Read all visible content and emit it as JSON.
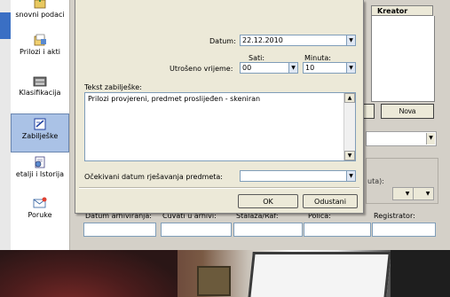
{
  "sidebar": {
    "items": [
      {
        "label": "snovni podaci",
        "icon": "folder-up-icon"
      },
      {
        "label": "Prilozi i akti",
        "icon": "attachments-icon"
      },
      {
        "label": "Klasifikacija",
        "icon": "classification-icon"
      },
      {
        "label": "Zabilješke",
        "icon": "notes-icon",
        "active": true
      },
      {
        "label": "etalji i Istorija",
        "icon": "history-icon"
      },
      {
        "label": "Poruke",
        "icon": "messages-icon"
      }
    ]
  },
  "background": {
    "kreator_header": "Kreator",
    "nova_button": "Nova",
    "minuta_partial": "uta):"
  },
  "archive": {
    "datum_label": "Datum arhiviranja:",
    "cuvati_label": "Čuvati u arhivi:",
    "stalaza_label": "Stalaža/Raf:",
    "polica_label": "Polica:",
    "registrator_label": "Registrator:"
  },
  "dialog": {
    "datum_label": "Datum:",
    "datum_value": "22.12.2010",
    "sati_label": "Sati:",
    "minuta_label": "Minuta:",
    "utroseno_label": "Utrošeno vrijeme:",
    "sati_value": "00",
    "minuta_value": "10",
    "tekst_label": "Tekst zabilješke:",
    "tekst_value": "Prilozi provjereni, predmet proslijeđen - skeniran",
    "ocekivani_label": "Očekivani datum rješavanja predmeta:",
    "ocekivani_value": "",
    "ok_label": "OK",
    "odustani_label": "Odustani"
  },
  "colors": {
    "window_bg": "#d4d0c8",
    "dialog_bg": "#ece9d8",
    "active_nav": "#aac2e6",
    "field_border": "#7f9db9"
  }
}
